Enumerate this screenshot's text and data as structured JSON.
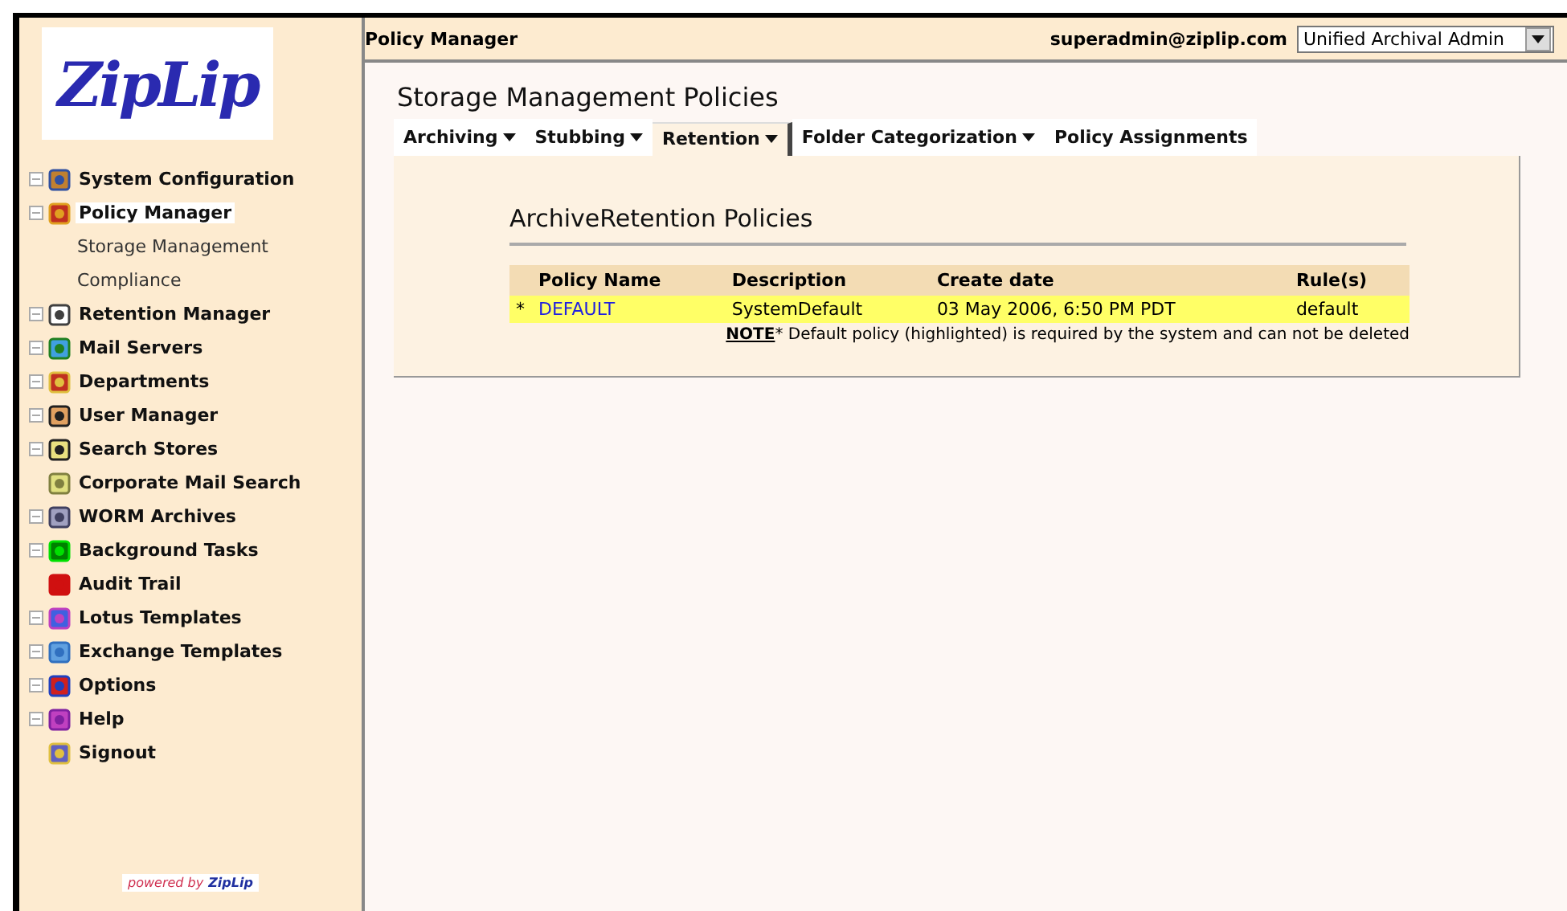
{
  "sidebar": {
    "logo": "ZipLip",
    "items": [
      {
        "label": "System Configuration",
        "toggle": true,
        "selected": false
      },
      {
        "label": "Policy Manager",
        "toggle": true,
        "selected": true,
        "children": [
          {
            "label": "Storage Management"
          },
          {
            "label": "Compliance"
          }
        ]
      },
      {
        "label": "Retention Manager",
        "toggle": true,
        "selected": false
      },
      {
        "label": "Mail Servers",
        "toggle": true,
        "selected": false
      },
      {
        "label": "Departments",
        "toggle": true,
        "selected": false
      },
      {
        "label": "User Manager",
        "toggle": true,
        "selected": false
      },
      {
        "label": "Search Stores",
        "toggle": true,
        "selected": false
      },
      {
        "label": "Corporate Mail Search",
        "toggle": false,
        "selected": false
      },
      {
        "label": "WORM Archives",
        "toggle": true,
        "selected": false
      },
      {
        "label": "Background Tasks",
        "toggle": true,
        "selected": false
      },
      {
        "label": "Audit Trail",
        "toggle": false,
        "selected": false
      },
      {
        "label": "Lotus Templates",
        "toggle": true,
        "selected": false
      },
      {
        "label": "Exchange Templates",
        "toggle": true,
        "selected": false
      },
      {
        "label": "Options",
        "toggle": true,
        "selected": false
      },
      {
        "label": "Help",
        "toggle": true,
        "selected": false
      },
      {
        "label": "Signout",
        "toggle": false,
        "selected": false
      }
    ],
    "powered_by": {
      "prefix": "powered by",
      "brand": "ZipLip"
    }
  },
  "header": {
    "title": "Policy Manager",
    "user": "superadmin@ziplip.com",
    "role_select": "Unified Archival Admin"
  },
  "page_title": "Storage Management Policies",
  "tabs": [
    {
      "label": "Archiving",
      "menu": true,
      "selected": false
    },
    {
      "label": "Stubbing",
      "menu": true,
      "selected": false
    },
    {
      "label": "Retention",
      "menu": true,
      "selected": true
    },
    {
      "label": "Folder Categorization",
      "menu": true,
      "selected": false
    },
    {
      "label": "Policy Assignments",
      "menu": false,
      "selected": false
    }
  ],
  "section_title": "ArchiveRetention Policies",
  "table": {
    "columns": [
      "Policy Name",
      "Description",
      "Create date",
      "Rule(s)"
    ],
    "rows": [
      {
        "marker": "*",
        "name": "DEFAULT",
        "description": "SystemDefault",
        "created": "03 May 2006, 6:50 PM PDT",
        "rules": "default",
        "highlighted": true
      }
    ]
  },
  "note": "**NOTE*** Default policy (highlighted) is required by the system and can not be deleted"
}
